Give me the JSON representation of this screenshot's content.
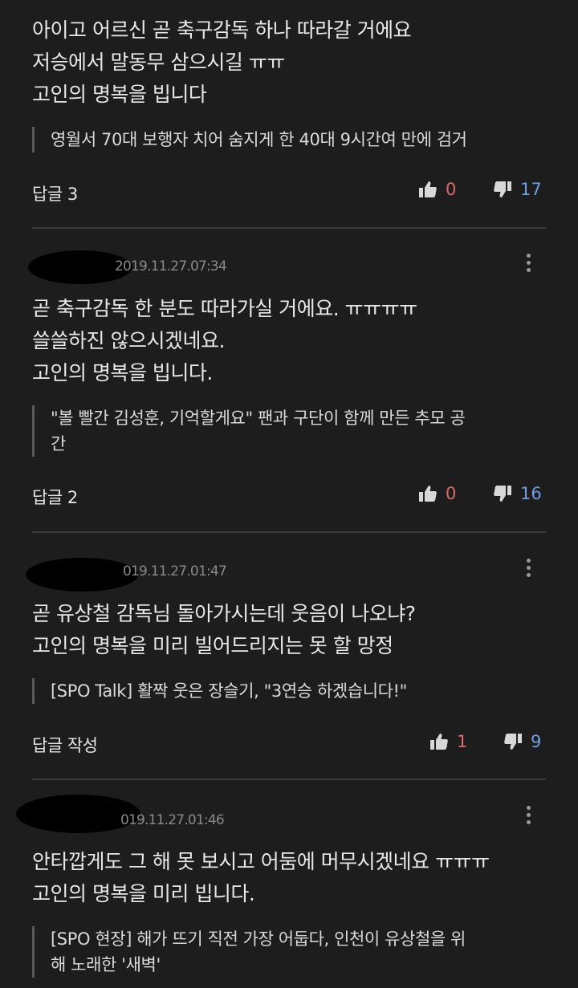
{
  "comments": [
    {
      "date": "",
      "lines": [
        "아이고 어르신 곧 축구감독 하나 따라갈 거에요",
        "저승에서 말동무 삼으시길 ㅠㅠ",
        "고인의 명복을 빕니다"
      ],
      "quote": "영월서 70대 보행자 치어 숨지게 한 40대 9시간여 만에 검거",
      "reply": "답글 3",
      "up": "0",
      "down": "17"
    },
    {
      "date": "2019.11.27.07:34",
      "lines": [
        "곧 축구감독 한 분도 따라가실 거에요. ㅠㅠㅠㅠ",
        "쓸쓸하진 않으시겠네요.",
        "고인의 명복을 빕니다."
      ],
      "quote_lines": [
        "\"볼 빨간 김성훈, 기억할게요\" 팬과 구단이 함께 만든 추모 공",
        "간"
      ],
      "reply": "답글 2",
      "up": "0",
      "down": "16"
    },
    {
      "date": "019.11.27.01:47",
      "lines": [
        "곧 유상철 감독님 돌아가시는데 웃음이 나오냐?",
        "고인의 명복을 미리 빌어드리지는 못 할 망정"
      ],
      "quote": "[SPO Talk] 활짝 웃은 장슬기, \"3연승 하겠습니다!\"",
      "reply": "답글 작성",
      "up": "1",
      "down": "9"
    },
    {
      "date": "019.11.27.01:46",
      "lines": [
        "안타깝게도 그 해 못 보시고 어둠에 머무시겠네요 ㅠㅠㅠ",
        "고인의 명복을 미리 빕니다."
      ],
      "quote_lines": [
        "[SPO 현장] 해가 뜨기 직전 가장 어둡다, 인천이 유상철을 위",
        "해 노래한 '새벽'"
      ]
    }
  ]
}
